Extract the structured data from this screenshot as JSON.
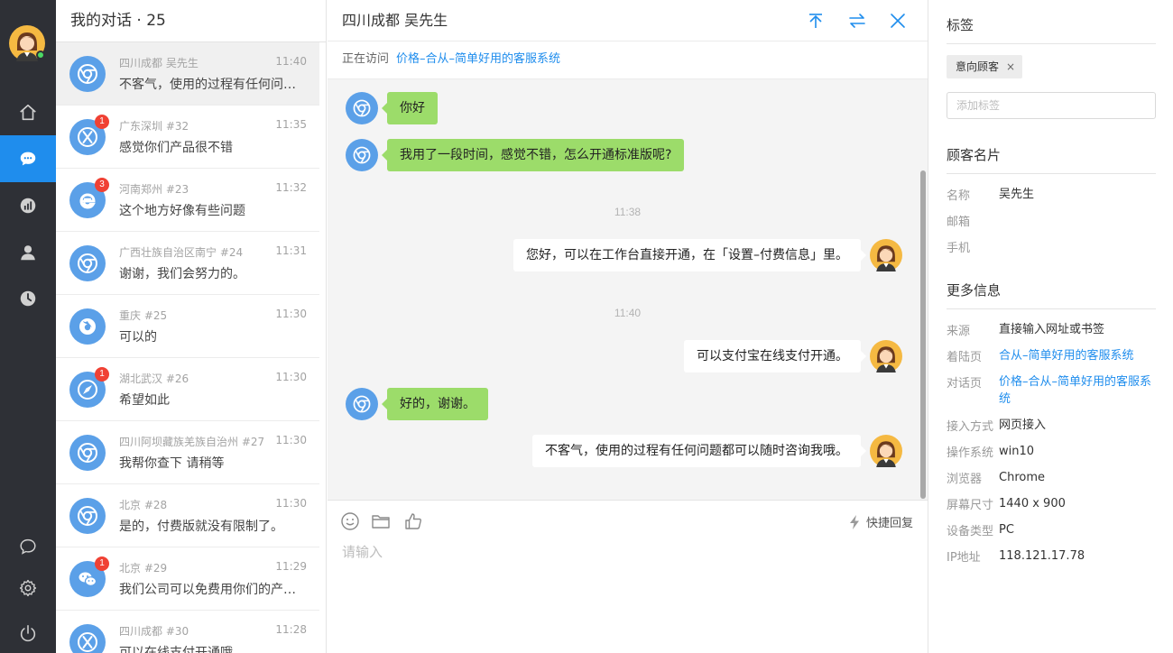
{
  "colors": {
    "accent": "#1f8ded",
    "nav_bg": "#2e3036",
    "bubble_in": "#9cdc6a",
    "badge": "#f04134",
    "online": "#4cd964"
  },
  "nav": {
    "items": [
      {
        "name": "home",
        "icon": "home-icon"
      },
      {
        "name": "conversations",
        "icon": "chat-bubble-icon",
        "active": true
      },
      {
        "name": "statistics",
        "icon": "chart-icon"
      },
      {
        "name": "contacts",
        "icon": "user-icon"
      },
      {
        "name": "history",
        "icon": "clock-icon"
      }
    ],
    "bottom": [
      {
        "name": "messages",
        "icon": "comment-icon"
      },
      {
        "name": "settings",
        "icon": "gear-icon"
      },
      {
        "name": "logout",
        "icon": "power-icon"
      }
    ]
  },
  "list": {
    "title": "我的对话 · 25",
    "items": [
      {
        "from": "四川成都 吴先生",
        "time": "11:40",
        "msg": "不客气，使用的过程有任何问题都可以随时咨询我哦。",
        "browser": "chrome",
        "badge": "",
        "active": true
      },
      {
        "from": "广东深圳 #32",
        "time": "11:35",
        "msg": "感觉你们产品很不错",
        "browser": "x",
        "badge": "1"
      },
      {
        "from": "河南郑州 #23",
        "time": "11:32",
        "msg": "这个地方好像有些问题",
        "browser": "ie",
        "badge": "3"
      },
      {
        "from": "广西壮族自治区南宁 #24",
        "time": "11:31",
        "msg": "谢谢，我们会努力的。",
        "browser": "chrome",
        "badge": ""
      },
      {
        "from": "重庆 #25",
        "time": "11:30",
        "msg": "可以的",
        "browser": "firefox",
        "badge": ""
      },
      {
        "from": "湖北武汉 #26",
        "time": "11:30",
        "msg": "希望如此",
        "browser": "safari",
        "badge": "1"
      },
      {
        "from": "四川阿坝藏族羌族自治州 #27",
        "time": "11:30",
        "msg": "我帮你查下 请稍等",
        "browser": "chrome",
        "badge": ""
      },
      {
        "from": "北京 #28",
        "time": "11:30",
        "msg": "是的，付费版就没有限制了。",
        "browser": "chrome",
        "badge": ""
      },
      {
        "from": "北京 #29",
        "time": "11:29",
        "msg": "我们公司可以免费用你们的产品吗？",
        "browser": "wechat",
        "badge": "1"
      },
      {
        "from": "四川成都 #30",
        "time": "11:28",
        "msg": "可以在线支付开通哦",
        "browser": "x",
        "badge": ""
      }
    ]
  },
  "chat": {
    "title": "四川成都 吴先生",
    "visiting_label": "正在访问",
    "visiting_page": "价格–合从–简单好用的客服系统",
    "messages": [
      {
        "side": "in",
        "text": "你好"
      },
      {
        "side": "in",
        "text": "我用了一段时间，感觉不错，怎么开通标准版呢?"
      },
      {
        "side": "time",
        "text": "11:38"
      },
      {
        "side": "out",
        "text": "您好，可以在工作台直接开通，在「设置–付费信息」里。"
      },
      {
        "side": "time",
        "text": "11:40"
      },
      {
        "side": "out",
        "text": "可以支付宝在线支付开通。"
      },
      {
        "side": "in",
        "text": "好的，谢谢。"
      },
      {
        "side": "out",
        "text": "不客气，使用的过程有任何问题都可以随时咨询我哦。"
      }
    ],
    "quick_reply": "快捷回复",
    "input_placeholder": "请输入"
  },
  "side": {
    "tags_title": "标签",
    "tags": [
      "意向顾客"
    ],
    "tag_placeholder": "添加标签",
    "card_title": "顾客名片",
    "card": [
      {
        "k": "名称",
        "v": "吴先生"
      },
      {
        "k": "邮箱",
        "v": ""
      },
      {
        "k": "手机",
        "v": ""
      }
    ],
    "more_title": "更多信息",
    "more": [
      {
        "k": "来源",
        "v": "直接输入网址或书签",
        "link": false
      },
      {
        "k": "着陆页",
        "v": "合从–简单好用的客服系统",
        "link": true
      },
      {
        "k": "对话页",
        "v": "价格–合从–简单好用的客服系统",
        "link": true
      },
      {
        "k": "接入方式",
        "v": "网页接入",
        "link": false
      },
      {
        "k": "操作系统",
        "v": "win10",
        "link": false
      },
      {
        "k": "浏览器",
        "v": "Chrome",
        "link": false
      },
      {
        "k": "屏幕尺寸",
        "v": "1440 x 900",
        "link": false
      },
      {
        "k": "设备类型",
        "v": "PC",
        "link": false
      },
      {
        "k": "IP地址",
        "v": "118.121.17.78",
        "link": false
      }
    ]
  }
}
